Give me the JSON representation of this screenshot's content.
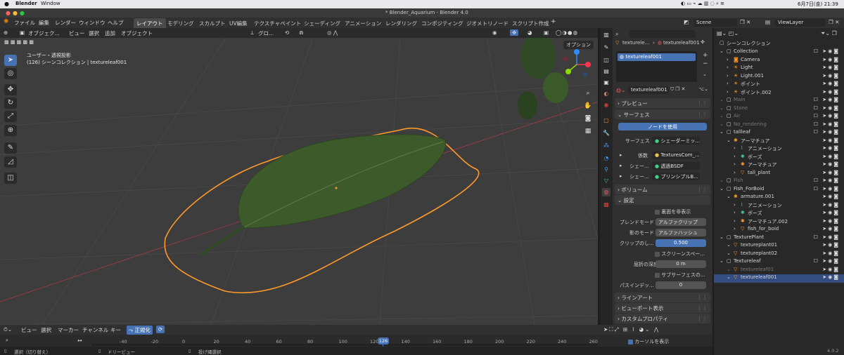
{
  "macbar": {
    "app": "Blender",
    "window_menu": "Window",
    "clock": "6月7日(金) 21:39"
  },
  "title": "* Blender_Aquarium - Blender 4.0",
  "menu": [
    "ファイル",
    "編集",
    "レンダー",
    "ウィンドウ",
    "ヘルプ"
  ],
  "workspaces": [
    "レイアウト",
    "モデリング",
    "スカルプト",
    "UV編集",
    "テクスチャペイント",
    "シェーディング",
    "アニメーション",
    "レンダリング",
    "コンポジティング",
    "ジオメトリノード",
    "スクリプト作成"
  ],
  "scene": "Scene",
  "viewlayer": "ViewLayer",
  "viewport": {
    "mode": "オブジェク...",
    "menus": [
      "ビュー",
      "選択",
      "追加",
      "オブジェクト"
    ],
    "orientation": "グロ...",
    "overlay_line1": "ユーザー・透視投影",
    "overlay_line2": "(126) シーンコレクション | textureleaf001",
    "options_label": "オプション"
  },
  "props": {
    "slot_name": "textureleaf001",
    "breadcrumb1": "textureleaf001",
    "breadcrumb2": "texturele...",
    "material_name": "textureleaf001",
    "sections": {
      "preview": "プレビュー",
      "surface": "サーフェス",
      "volume": "ボリューム",
      "settings": "設定",
      "lineart": "ラインアート",
      "viewport_display": "ビューポート表示",
      "custom_props": "カスタムプロパティ"
    },
    "use_nodes": "ノードを使用",
    "surface_label": "サーフェス",
    "surface_value": "シェーダーミッ...",
    "factor_label": "係数",
    "factor_value": "TexturesCom_...",
    "shader1_label": "シェー...",
    "shader1_value": "透過BSDF",
    "shader2_label": "シェー...",
    "shader2_value": "プリンシプルB...",
    "backface": "裏面を非表示",
    "blend_label": "ブレンドモード",
    "blend_value": "アルファクリップ",
    "shadow_label": "影のモード",
    "shadow_value": "アルファハッシュ",
    "clip_label": "クリップのし...",
    "clip_value": "0.500",
    "screen_space": "スクリーンスペー...",
    "refraction_label": "屈折の深度",
    "refraction_value": "0 m",
    "subsurface": "サブサーフェスの...",
    "pass_label": "パスインデッ...",
    "pass_value": "0"
  },
  "outliner": {
    "root": "シーンコレクション",
    "rows": [
      {
        "label": "Collection",
        "indent": 1,
        "icon": "collection"
      },
      {
        "label": "Camera",
        "indent": 2,
        "icon": "camera"
      },
      {
        "label": "Light",
        "indent": 2,
        "icon": "light"
      },
      {
        "label": "Light.001",
        "indent": 2,
        "icon": "light"
      },
      {
        "label": "ポイント",
        "indent": 2,
        "icon": "light"
      },
      {
        "label": "ポイント.002",
        "indent": 2,
        "icon": "light"
      },
      {
        "label": "Main",
        "indent": 1,
        "icon": "collection",
        "dim": true
      },
      {
        "label": "Stone",
        "indent": 1,
        "icon": "collection",
        "dim": true
      },
      {
        "label": "Air",
        "indent": 1,
        "icon": "collection",
        "dim": true
      },
      {
        "label": "No_rendering",
        "indent": 1,
        "icon": "collection",
        "dim": true
      },
      {
        "label": "tallleaf",
        "indent": 1,
        "icon": "collection"
      },
      {
        "label": "アーマチュア",
        "indent": 2,
        "icon": "armature"
      },
      {
        "label": "アニメーション",
        "indent": 3,
        "icon": "anim"
      },
      {
        "label": "ポーズ",
        "indent": 3,
        "icon": "pose"
      },
      {
        "label": "アーマチュア",
        "indent": 3,
        "icon": "armature"
      },
      {
        "label": "tall_plant",
        "indent": 3,
        "icon": "mesh"
      },
      {
        "label": "Fish",
        "indent": 1,
        "icon": "collection",
        "dim": true
      },
      {
        "label": "Fish_ForBoid",
        "indent": 1,
        "icon": "collection"
      },
      {
        "label": "armature.001",
        "indent": 2,
        "icon": "armature"
      },
      {
        "label": "アニメーション",
        "indent": 3,
        "icon": "anim"
      },
      {
        "label": "ポーズ",
        "indent": 3,
        "icon": "pose"
      },
      {
        "label": "アーマチュア.002",
        "indent": 3,
        "icon": "armature"
      },
      {
        "label": "fish_for_boid",
        "indent": 3,
        "icon": "mesh"
      },
      {
        "label": "TexturePlant",
        "indent": 1,
        "icon": "collection"
      },
      {
        "label": "textureplant01",
        "indent": 2,
        "icon": "mesh"
      },
      {
        "label": "textureplant02",
        "indent": 2,
        "icon": "mesh"
      },
      {
        "label": "Textureleaf",
        "indent": 1,
        "icon": "collection"
      },
      {
        "label": "textureleaf01",
        "indent": 2,
        "icon": "mesh",
        "dim": true
      },
      {
        "label": "textureleaf001",
        "indent": 2,
        "icon": "mesh",
        "selected": true
      }
    ]
  },
  "timeline": {
    "menus": [
      "ビュー",
      "選択",
      "マーカー",
      "チャンネル",
      "キー"
    ],
    "normalize": "正規化",
    "ticks": [
      "-40",
      "-20",
      "0",
      "20",
      "40",
      "60",
      "80",
      "100",
      "120",
      "140",
      "160",
      "180",
      "200",
      "220",
      "240",
      "260"
    ],
    "current_frame": "126",
    "show_cursor": "カーソルを表示"
  },
  "status": {
    "select": "選択（切り替え）",
    "dolly": "ドリービュー",
    "lasso": "投げ縄選択",
    "version": "4.0.2"
  },
  "colors": {
    "accent": "#4772b3",
    "selection_outline": "#ff9a2a",
    "leaf": "#3d5a2a"
  }
}
